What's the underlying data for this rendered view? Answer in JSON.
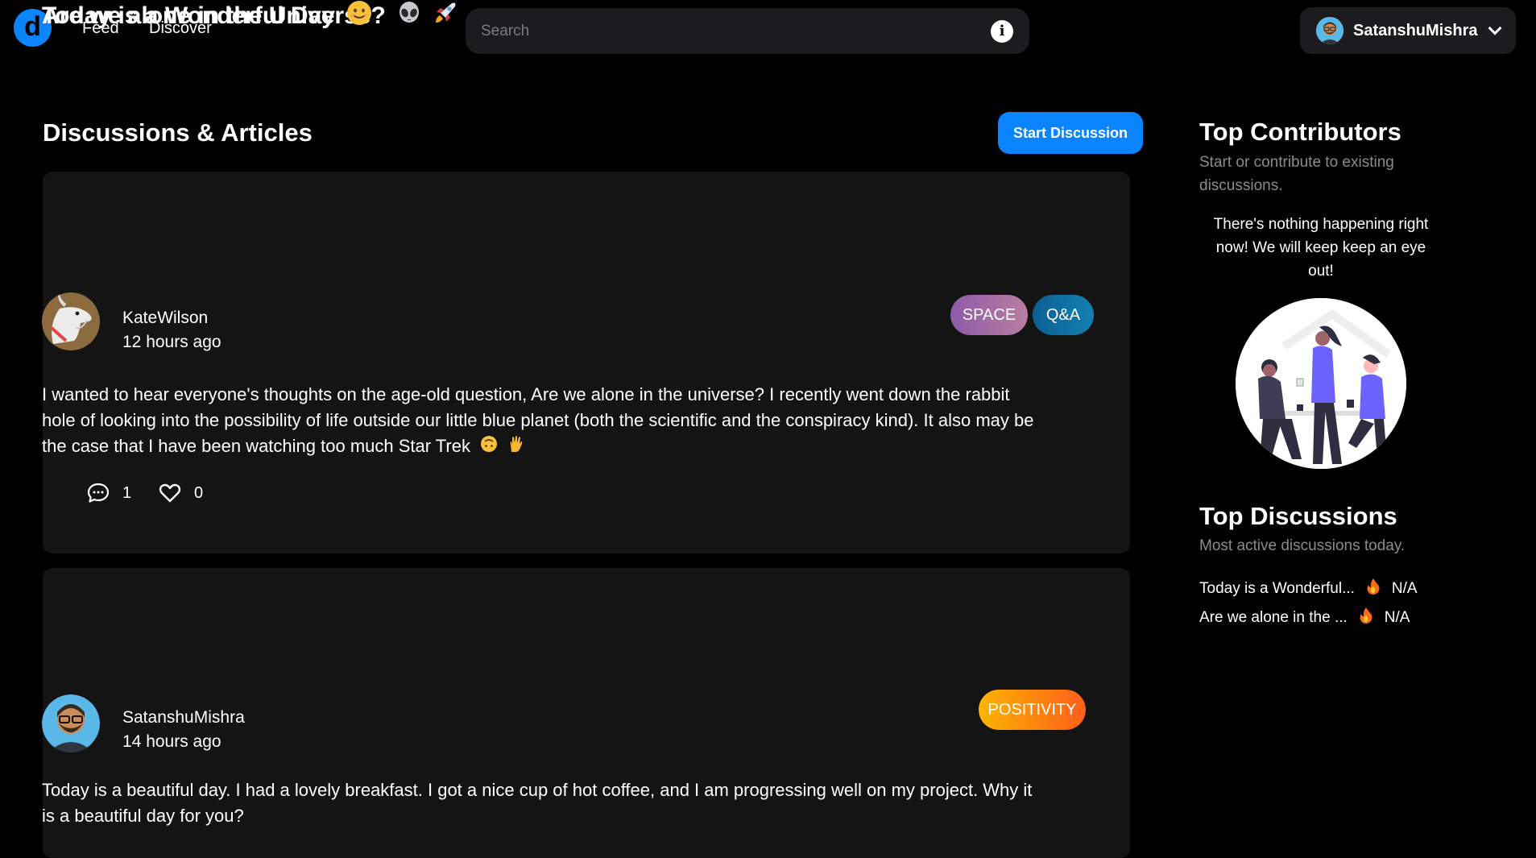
{
  "header": {
    "logo_letter": "d",
    "nav": {
      "feed": "Feed",
      "discover": "Discover"
    },
    "search_placeholder": "Search",
    "user_name": "SatanshuMishra"
  },
  "main": {
    "title": "Discussions & Articles",
    "start_button": "Start Discussion",
    "posts": [
      {
        "title": "Are we alone in the Universe?",
        "author": "KateWilson",
        "time": "12 hours ago",
        "tags": [
          "SPACE",
          "Q&A"
        ],
        "body": "I wanted to hear everyone's thoughts on the age-old question, Are we alone in the universe? I recently went down the rabbit hole of looking into the possibility of life outside our little blue planet (both the scientific and the conspiracy kind). It also may be the case that I have been watching too much Star Trek",
        "comments": "1",
        "likes": "0"
      },
      {
        "title": "Today is a Wonderful Day",
        "author": "SatanshuMishra",
        "time": "14 hours ago",
        "tags": [
          "POSITIVITY"
        ],
        "body": "Today is a beautiful day. I had a lovely breakfast. I got a nice cup of hot coffee, and I am progressing well on my project. Why it is a beautiful day for you?"
      }
    ]
  },
  "sidebar": {
    "contributors_title": "Top Contributors",
    "contributors_sub": "Start or contribute to existing discussions.",
    "empty_message": "There's nothing happening right now! We will keep keep an eye out!",
    "discussions_title": "Top Discussions",
    "discussions_sub": "Most active discussions today.",
    "top_discussions": [
      {
        "title": "Today is a Wonderful...",
        "value": "N/A"
      },
      {
        "title": "Are we alone in the ...",
        "value": "N/A"
      }
    ]
  },
  "colors": {
    "accent": "#0a84ff",
    "card_bg": "#141414",
    "tag_space": "#8e5aa8",
    "tag_qa": "#0d6aa0",
    "tag_positivity": "#ff8a00"
  }
}
